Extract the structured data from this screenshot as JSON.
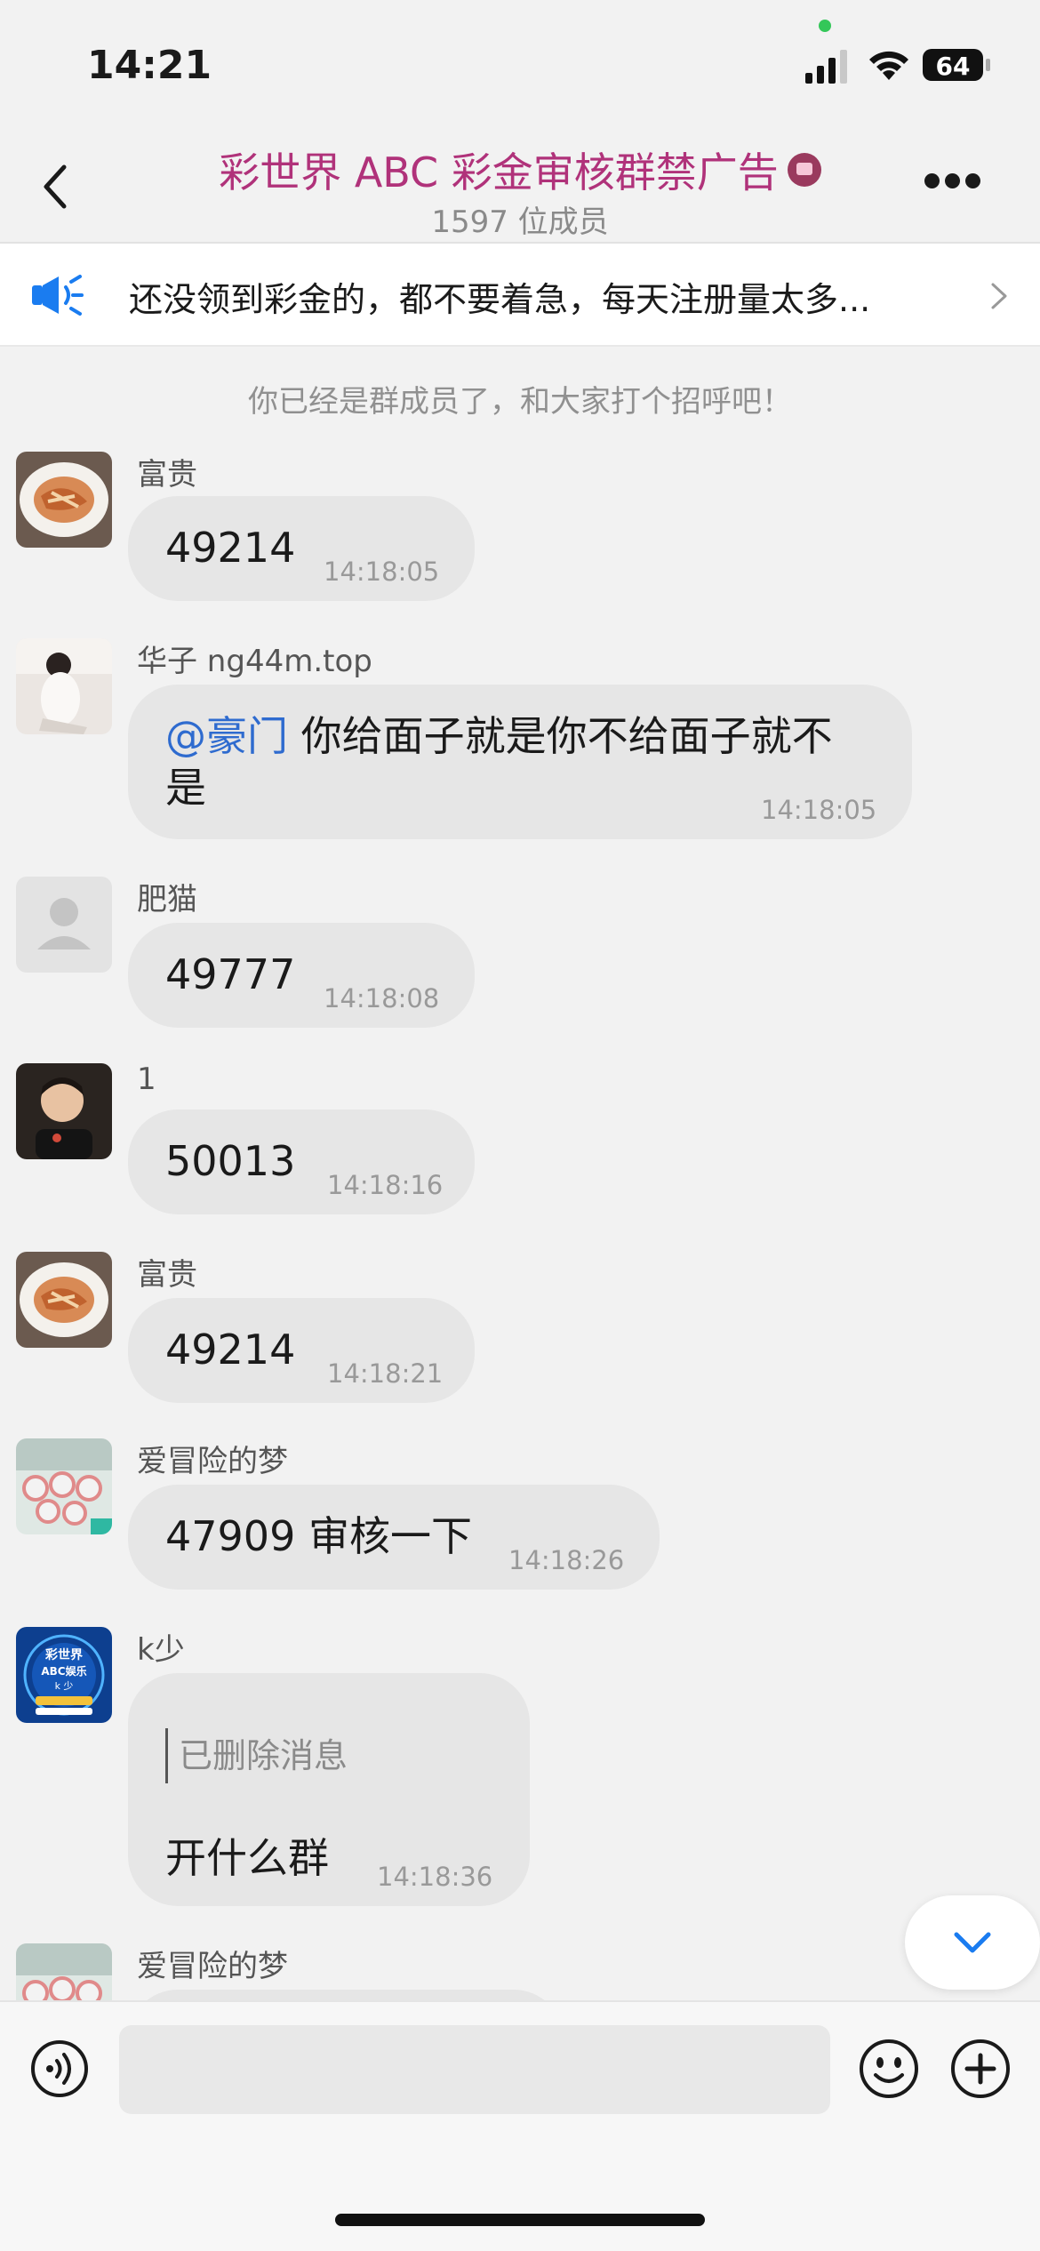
{
  "status_bar": {
    "time": "14:21",
    "battery": "64"
  },
  "header": {
    "title": "彩世界 ABC 彩金审核群禁广告",
    "member_count": "1597 位成员"
  },
  "announcement": {
    "text": "还没领到彩金的，都不要着急，每天注册量太多..."
  },
  "system_tip": "你已经是群成员了，和大家打个招呼吧！",
  "messages": [
    {
      "sender": "富贵",
      "text": "49214",
      "time": "14:18:05"
    },
    {
      "sender": "华子 ng44m.top",
      "mention": "@豪门",
      "text_line1": "你给面子就是你不给面子就不",
      "text_line2": "是",
      "time": "14:18:05"
    },
    {
      "sender": "肥猫",
      "text": "49777",
      "time": "14:18:08"
    },
    {
      "sender": "1",
      "text": "50013",
      "time": "14:18:16"
    },
    {
      "sender": "富贵",
      "text": "49214",
      "time": "14:18:21"
    },
    {
      "sender": "爱冒险的梦",
      "text": "47909 审核一下",
      "time": "14:18:26"
    },
    {
      "sender": "k少",
      "quote": "已删除消息",
      "text": "开什么群",
      "time": "14:18:36"
    },
    {
      "sender": "爱冒险的梦"
    }
  ],
  "avatar_texts": {
    "ksao_line1": "彩世界",
    "ksao_line2": "ABC娱乐",
    "ksao_line3": "k 少"
  },
  "colors": {
    "title": "#b0327a",
    "mention": "#2e6bcf",
    "bubble": "#e6e6e6",
    "accent_blue": "#1a7cf0"
  },
  "icons": [
    "back-chevron-icon",
    "more-dots-icon",
    "speaker-icon",
    "chevron-right-icon",
    "chevron-down-icon",
    "voice-icon",
    "emoji-icon",
    "plus-icon"
  ]
}
